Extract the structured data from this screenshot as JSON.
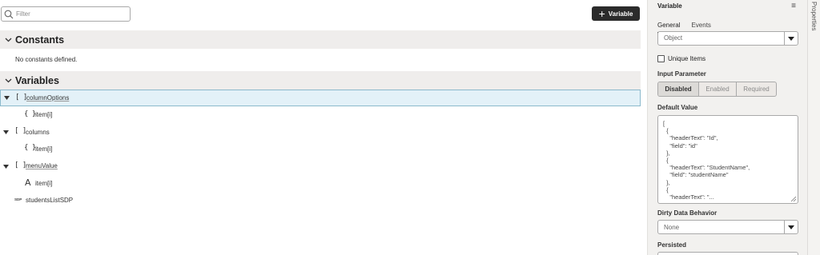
{
  "filter": {
    "placeholder": "Filter",
    "value": ""
  },
  "toolbar": {
    "add_variable_label": "Variable"
  },
  "constants": {
    "title": "Constants",
    "empty_text": "No constants defined."
  },
  "variables": {
    "title": "Variables",
    "items": [
      {
        "name": "columnOptions",
        "type_icon": "array-icon",
        "glyph": "[ ]",
        "expanded": true,
        "selected": true,
        "children": [
          {
            "name": "item[i]",
            "type_icon": "object-icon",
            "glyph": "{ }"
          }
        ]
      },
      {
        "name": "columns",
        "type_icon": "array-icon",
        "glyph": "[ ]",
        "expanded": true,
        "children": [
          {
            "name": "item[i]",
            "type_icon": "object-icon",
            "glyph": "{ }"
          }
        ]
      },
      {
        "name": "menuValue",
        "type_icon": "array-icon",
        "glyph": "[ ]",
        "expanded": true,
        "children": [
          {
            "name": "item[i]",
            "type_icon": "string-icon",
            "glyph": "A"
          }
        ]
      },
      {
        "name": "studentsListSDP",
        "type_icon": "sdp-icon",
        "glyph": "SDP"
      }
    ]
  },
  "panel": {
    "title": "Variable",
    "menu_icon": "hamburger-menu-icon",
    "tabs": [
      {
        "label": "General",
        "active": true
      },
      {
        "label": "Events",
        "active": false
      }
    ],
    "type_select": {
      "value": "Object"
    },
    "unique_items": {
      "label": "Unique Items",
      "checked": false
    },
    "input_parameter": {
      "label": "Input Parameter",
      "options": [
        {
          "label": "Disabled",
          "selected": true
        },
        {
          "label": "Enabled",
          "selected": false
        },
        {
          "label": "Required",
          "selected": false
        }
      ]
    },
    "default_value": {
      "label": "Default Value",
      "value": "[\n  {\n    \"headerText\": \"Id\",\n    \"field\": \"id\"\n  },\n  {\n    \"headerText\": \"StudentName\",\n    \"field\": \"studentName\"\n  },\n  {\n    \"headerText\": \"..."
    },
    "dirty_data_behavior": {
      "label": "Dirty Data Behavior",
      "value": "None"
    },
    "persisted": {
      "label": "Persisted"
    }
  },
  "sidebar": {
    "label": "Properties"
  },
  "colors": {
    "selected_row_bg": "#e3f1f8",
    "selected_row_border": "#8bb9cc",
    "section_bg": "#efedec",
    "button_bg": "#2b2b2b",
    "panel_bg": "#f2f1ef"
  }
}
